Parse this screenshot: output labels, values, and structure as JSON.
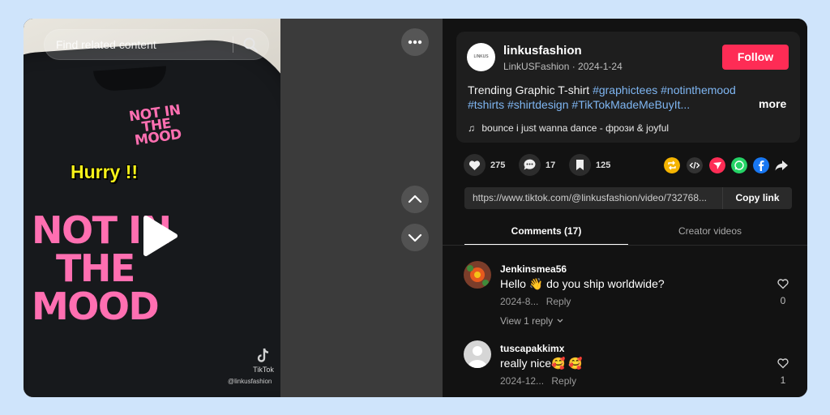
{
  "search": {
    "placeholder": "Find related content"
  },
  "video": {
    "overlay_caption": "Hurry !!",
    "print_small": "NOT IN THE MOOD",
    "print_big_lines": [
      "NOT IN",
      "THE",
      "MOOD"
    ],
    "watermark": "TikTok",
    "watermark_handle": "@linkusfashion"
  },
  "author": {
    "username": "linkusfashion",
    "display_name_date": "LinkUSFashion · 2024-1-24",
    "avatar_text": "LINKUS FASHION"
  },
  "follow_label": "Follow",
  "description": {
    "text": "Trending Graphic T-shirt",
    "tags": [
      "#graphictees",
      "#notinthemood",
      "#tshirts",
      "#shirtdesign",
      "#TikTokMadeMeBuyIt..."
    ],
    "more_label": "more"
  },
  "music": "bounce i just wanna dance - фрози & joyful",
  "stats": {
    "likes": "275",
    "comments": "17",
    "saves": "125"
  },
  "share_icons": [
    "repost-icon",
    "embed-icon",
    "send-icon",
    "whatsapp-icon",
    "facebook-icon",
    "share-arrow-icon"
  ],
  "link": {
    "url": "https://www.tiktok.com/@linkusfashion/video/732768...",
    "copy_label": "Copy link"
  },
  "tabs": {
    "comments": "Comments (17)",
    "creator": "Creator videos"
  },
  "comments": [
    {
      "user": "Jenkinsmea56",
      "text": "Hello 👋 do you ship worldwide?",
      "date": "2024-8...",
      "reply_label": "Reply",
      "likes": "0",
      "view_replies": "View 1 reply"
    },
    {
      "user": "tuscapakkimx",
      "text": "really nice🥰 🥰",
      "date": "2024-12...",
      "reply_label": "Reply",
      "likes": "1"
    }
  ],
  "colors": {
    "accent": "#fe2c55",
    "hashtag": "#7fb6f2",
    "print_pink": "#ff6fb1",
    "caption_yellow": "#f7f21a"
  }
}
